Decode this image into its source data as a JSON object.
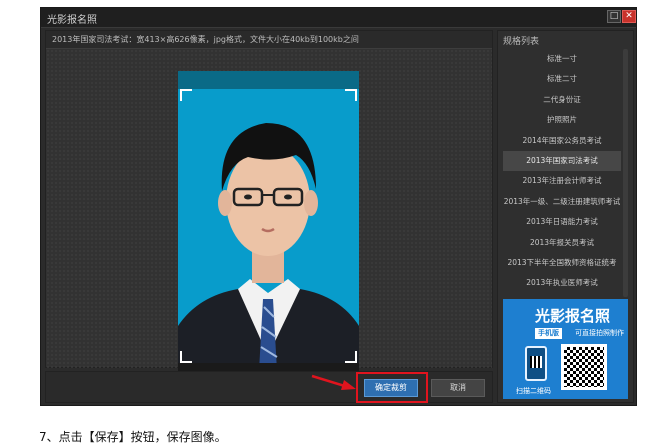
{
  "window": {
    "title": "光影报名照",
    "maximize_glyph": "□",
    "close_glyph": "✕"
  },
  "editor": {
    "info_text": "2013年国家司法考试：宽413×高626像素，jpg格式，文件大小在40kb到100kb之间"
  },
  "buttons": {
    "confirm": "确定裁剪",
    "cancel": "取消"
  },
  "sidebar": {
    "title": "规格列表",
    "items": [
      {
        "label": "标准一寸"
      },
      {
        "label": "标准二寸"
      },
      {
        "label": "二代身份证"
      },
      {
        "label": "护照照片"
      },
      {
        "label": "2014年国家公务员考试"
      },
      {
        "label": "2013年国家司法考试"
      },
      {
        "label": "2013年注册会计师考试"
      },
      {
        "label": "2013年一级、二级注册建筑师考试"
      },
      {
        "label": "2013年日语能力考试"
      },
      {
        "label": "2013年报关员考试"
      },
      {
        "label": "2013下半年全国教师资格证统考"
      },
      {
        "label": "2013年执业医师考试"
      }
    ],
    "selected_index": 5
  },
  "ad": {
    "title": "光影报名照",
    "badge": "手机版",
    "subtitle": "可直接拍照制作",
    "scan_text": "扫描二维码"
  },
  "caption": "7、点击【保存】按钮，保存图像。",
  "colors": {
    "photo_background": "#089ccb",
    "highlight": "#e0141e",
    "confirm_button": "#2e6fb1"
  }
}
